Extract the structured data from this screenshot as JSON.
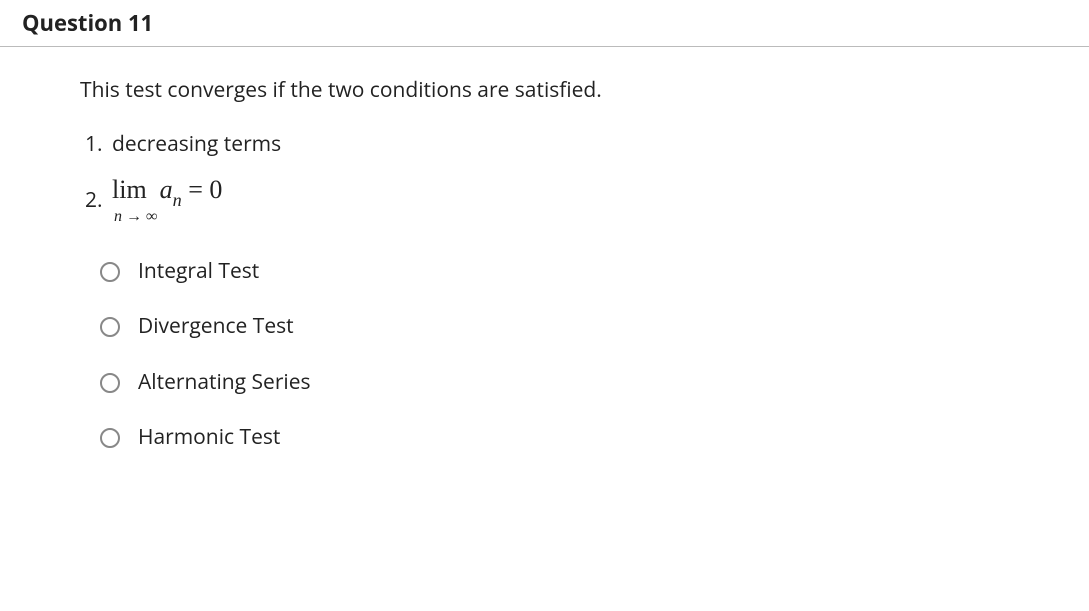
{
  "header": "Question 11",
  "prompt": "This test converges if the two conditions are satisfied.",
  "conditions": {
    "c1": "decreasing terms",
    "c2_lim": "lim",
    "c2_var": "a",
    "c2_sub": "n",
    "c2_eq": "= 0",
    "c2_under": "n → ∞"
  },
  "options": [
    {
      "label": "Integral Test"
    },
    {
      "label": "Divergence Test"
    },
    {
      "label": "Alternating Series"
    },
    {
      "label": "Harmonic Test"
    }
  ]
}
